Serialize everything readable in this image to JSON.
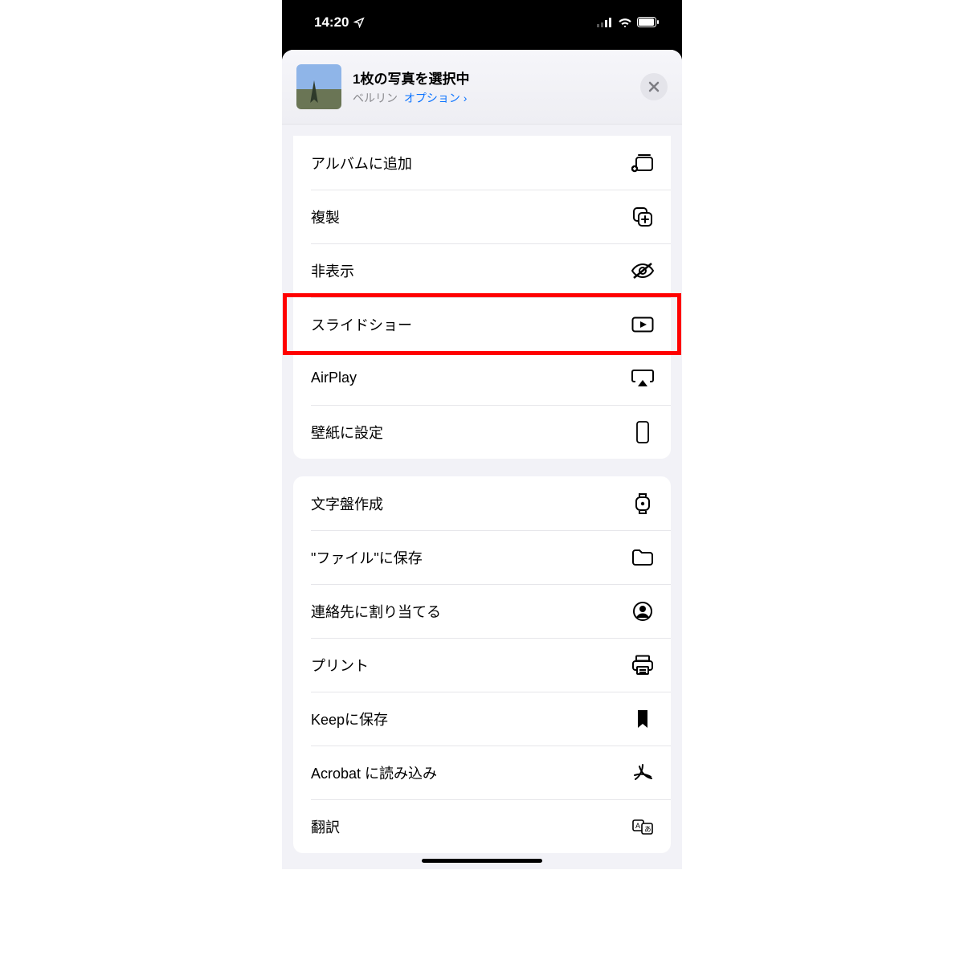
{
  "status": {
    "time": "14:20"
  },
  "header": {
    "title": "1枚の写真を選択中",
    "location": "ベルリン",
    "options_label": "オプション",
    "chevron": "›"
  },
  "group1": {
    "items": [
      {
        "label": "アルバムに追加"
      },
      {
        "label": "複製"
      },
      {
        "label": "非表示"
      },
      {
        "label": "スライドショー"
      },
      {
        "label": "AirPlay"
      },
      {
        "label": "壁紙に設定"
      }
    ]
  },
  "group2": {
    "items": [
      {
        "label": "文字盤作成"
      },
      {
        "label": "\"ファイル\"に保存"
      },
      {
        "label": "連絡先に割り当てる"
      },
      {
        "label": "プリント"
      },
      {
        "label": "Keepに保存"
      },
      {
        "label": "Acrobat に読み込み"
      },
      {
        "label": "翻訳"
      }
    ]
  }
}
